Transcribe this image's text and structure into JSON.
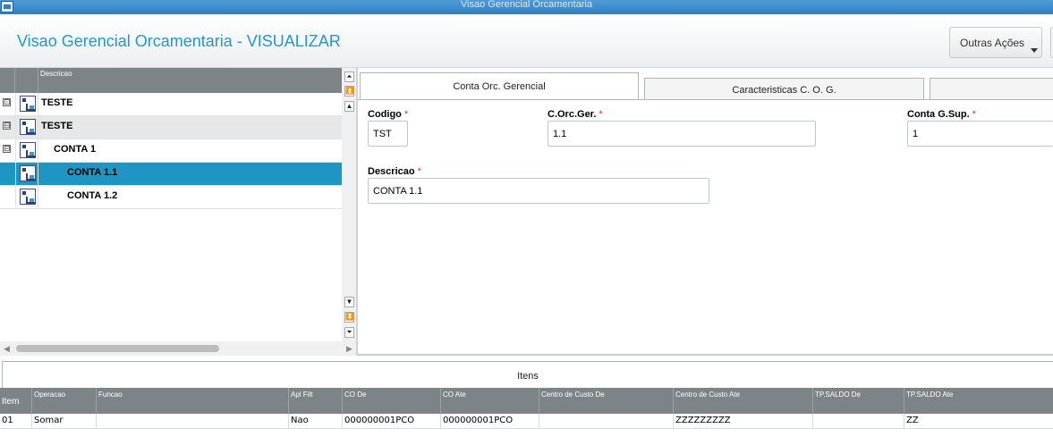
{
  "window": {
    "title": "Visao Gerencial Orcamentaria"
  },
  "header": {
    "title": "Visao Gerencial Orcamentaria - VISUALIZAR",
    "outras_acoes": "Outras Ações"
  },
  "tree": {
    "column_header": "Descricao",
    "rows": [
      {
        "label": "TESTE",
        "expander": "⊡"
      },
      {
        "label": "TESTE",
        "expander": "⊟"
      },
      {
        "label": "CONTA 1",
        "expander": "⊟"
      },
      {
        "label": "CONTA 1.1",
        "expander": ""
      },
      {
        "label": "CONTA 1.2",
        "expander": ""
      }
    ],
    "selected_index": 3
  },
  "tabs": [
    {
      "label": "Conta Orc. Gerencial",
      "active": true
    },
    {
      "label": "Caracteristicas C. O. G.",
      "active": false
    },
    {
      "label": "",
      "active": false
    }
  ],
  "form": {
    "codigo": {
      "label": "Codigo",
      "required_mark": "*",
      "value": "TST"
    },
    "corcger": {
      "label": "C.Orc.Ger.",
      "required_mark": "*",
      "value": "1.1"
    },
    "contagsup": {
      "label": "Conta G.Sup.",
      "required_mark": "*",
      "value": "1"
    },
    "descricao": {
      "label": "Descricao",
      "required_mark": "*",
      "value": "CONTA 1.1"
    }
  },
  "items": {
    "tab_label": "Itens",
    "columns": [
      "Item",
      "Operacao",
      "Funcao",
      "Apl Filt",
      "CO De",
      "CO Ate",
      "Centro de Custo De",
      "Centro de Custo Ate",
      "TP.SALDO De",
      "TP.SALDO Ate"
    ],
    "rows": [
      [
        "01",
        "Somar",
        "",
        "Nao",
        "000000001PCO",
        "000000001PCO",
        "",
        "ZZZZZZZZZ",
        "",
        "ZZ"
      ]
    ]
  },
  "colors": {
    "accent": "#2199c9",
    "selected_row": "#1f95c4",
    "grid_header": "#7d8488",
    "required": "#e03131"
  }
}
